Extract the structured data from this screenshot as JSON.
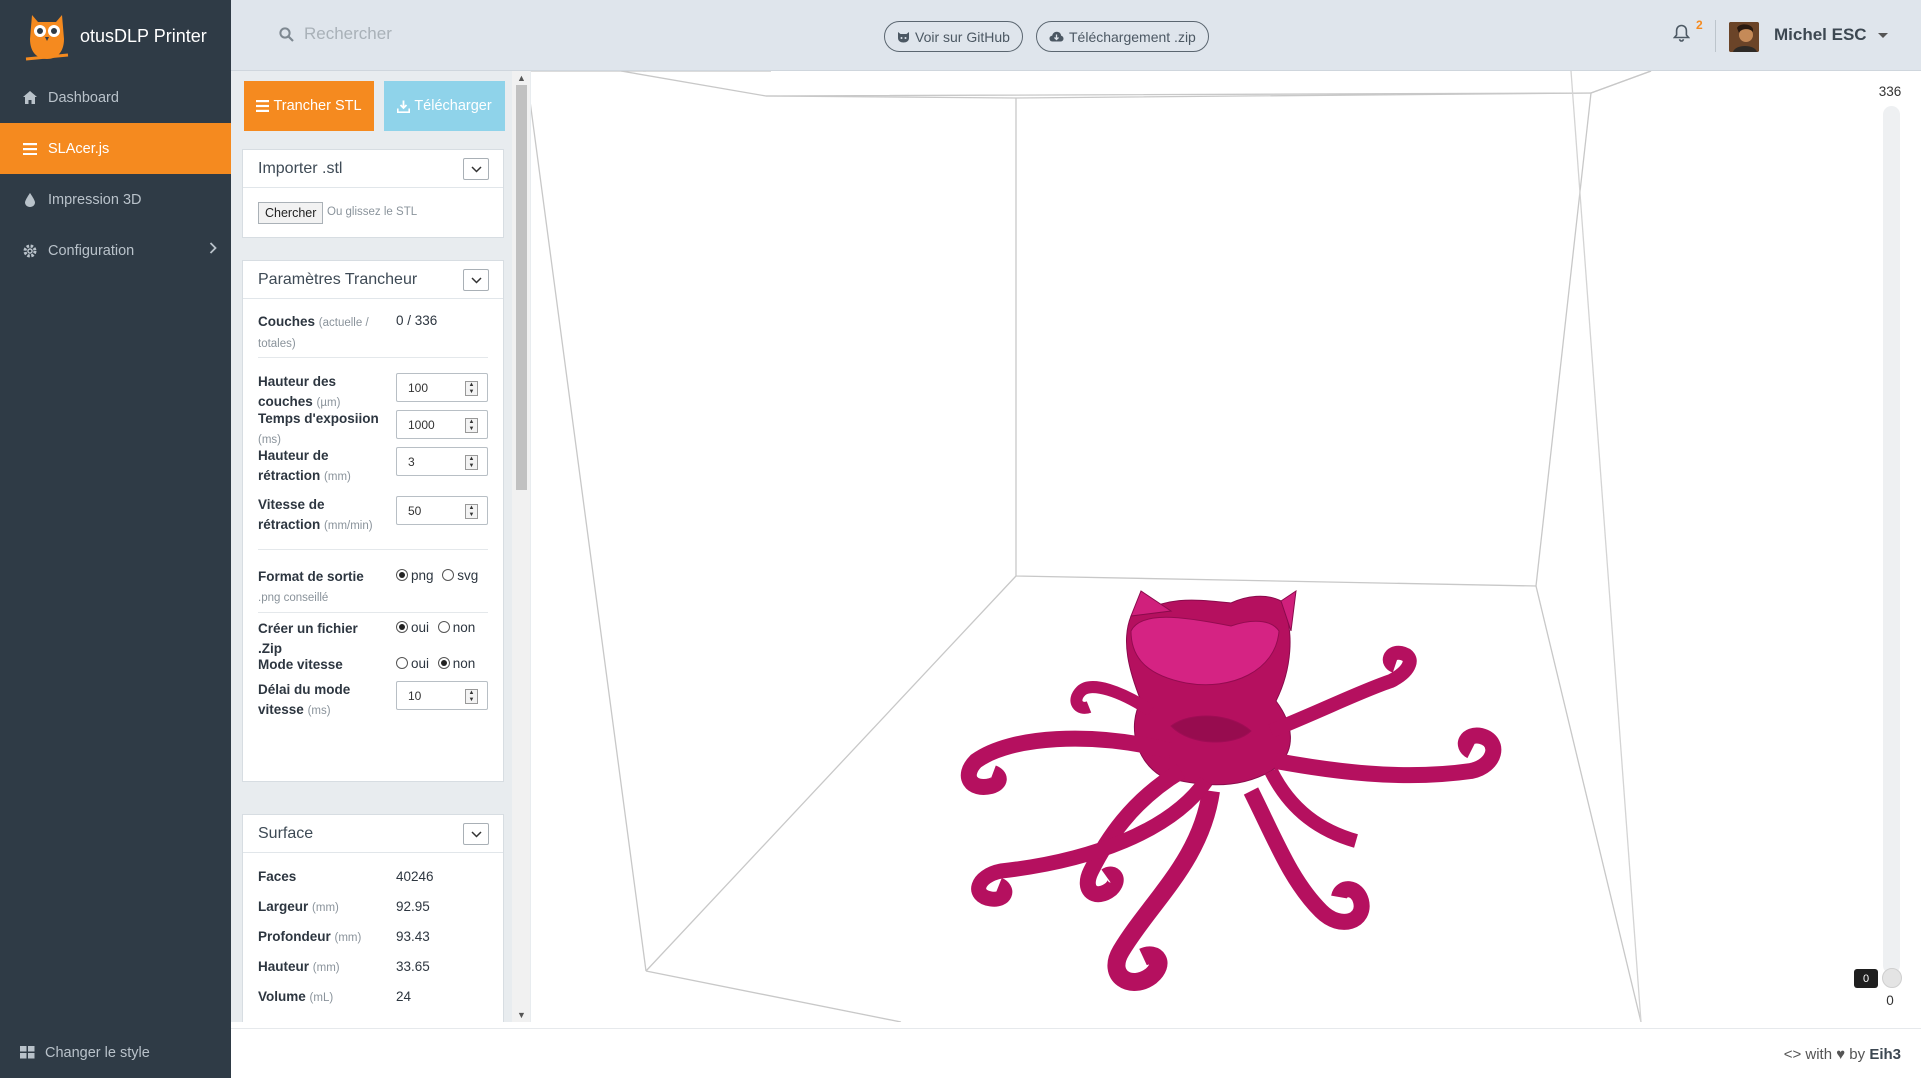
{
  "app": {
    "title": "otusDLP Printer"
  },
  "sidebar": {
    "items": [
      {
        "label": "Dashboard",
        "icon": "home-icon"
      },
      {
        "label": "SLAcer.js",
        "icon": "list-icon",
        "active": true
      },
      {
        "label": "Impression 3D",
        "icon": "droplet-icon"
      },
      {
        "label": "Configuration",
        "icon": "gear-icon"
      }
    ],
    "footer_label": "Changer le style"
  },
  "topbar": {
    "search_placeholder": "Rechercher",
    "github_label": "Voir sur GitHub",
    "download_label": "Téléchargement .zip",
    "notification_count": "2",
    "username": "Michel ESC"
  },
  "toolbar": {
    "slice_label": "Trancher STL",
    "download_label": "Télécharger"
  },
  "import_card": {
    "title": "Importer .stl",
    "browse_label": "Chercher",
    "hint": "Ou glissez le STL"
  },
  "slicer_card": {
    "title": "Paramètres Trancheur",
    "layers_label": "Couches",
    "layers_sub": "(actuelle / totales)",
    "layers_value": "0 / 336",
    "layer_height_label": "Hauteur des couches",
    "layer_height_unit": "(µm)",
    "layer_height_value": "100",
    "exposure_label": "Temps d'exposiion",
    "exposure_unit": "(ms)",
    "exposure_value": "1000",
    "retract_height_label": "Hauteur de rétraction",
    "retract_height_unit": "(mm)",
    "retract_height_value": "3",
    "retract_speed_label": "Vitesse de rétraction",
    "retract_speed_unit": "(mm/min)",
    "retract_speed_value": "50",
    "output_label": "Format de sortie",
    "output_hint": ".png conseillé",
    "output_png": "png",
    "output_svg": "svg",
    "zip_label": "Créer un fichier .Zip",
    "zip_yes": "oui",
    "zip_no": "non",
    "speed_mode_label": "Mode vitesse",
    "speed_yes": "oui",
    "speed_no": "non",
    "speed_delay_label": "Délai du mode vitesse",
    "speed_delay_unit": "(ms)",
    "speed_delay_value": "10"
  },
  "surface_card": {
    "title": "Surface",
    "faces_label": "Faces",
    "faces_value": "40246",
    "width_label": "Largeur",
    "width_unit": "(mm)",
    "width_value": "92.95",
    "depth_label": "Profondeur",
    "depth_unit": "(mm)",
    "depth_value": "93.43",
    "height_label": "Hauteur",
    "height_unit": "(mm)",
    "height_value": "33.65",
    "volume_label": "Volume",
    "volume_unit": "(mL)",
    "volume_value": "24"
  },
  "layer_slider": {
    "max_label": "336",
    "min_label": "0",
    "current": "0",
    "fraction": 0
  },
  "footer": {
    "prefix": "<> with ♥ by",
    "author": "Eih3"
  },
  "colors": {
    "accent_orange": "#f58a1f",
    "sidebar_bg": "#2f3b46",
    "model_magenta": "#c4146e"
  }
}
